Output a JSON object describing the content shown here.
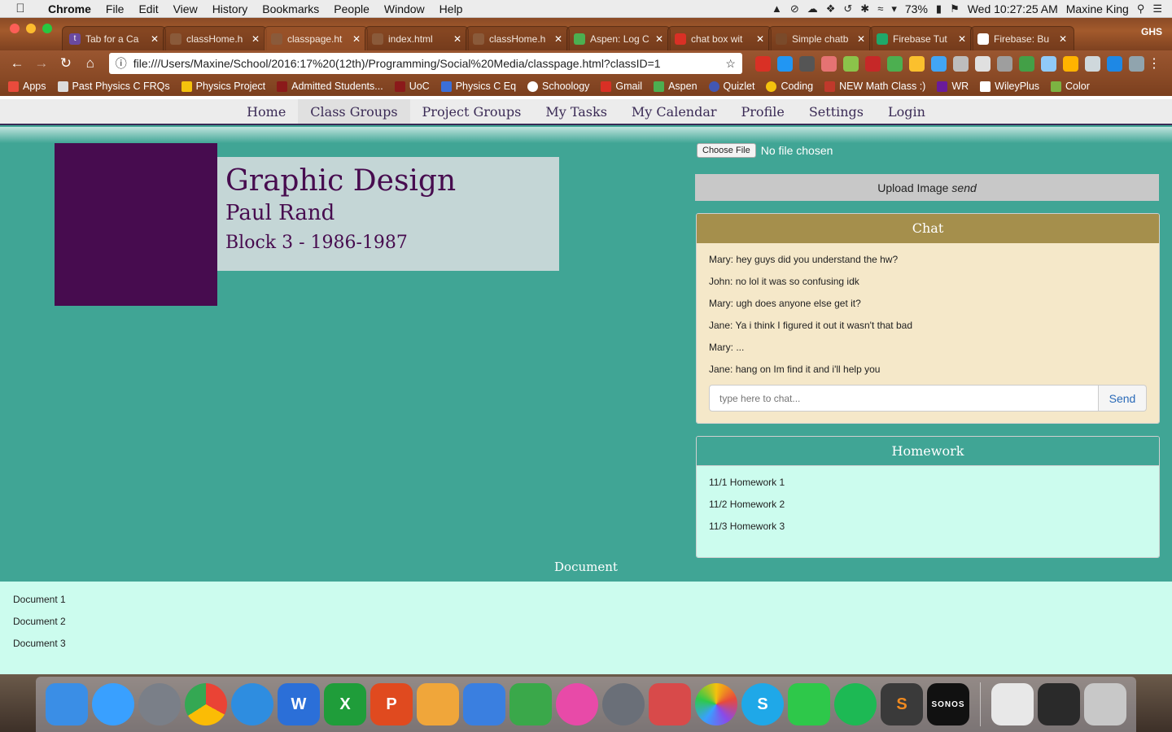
{
  "menubar": {
    "app": "Chrome",
    "items": [
      "File",
      "Edit",
      "View",
      "History",
      "Bookmarks",
      "People",
      "Window",
      "Help"
    ],
    "battery": "73%",
    "clock": "Wed 10:27:25 AM",
    "user": "Maxine King"
  },
  "tabs": [
    {
      "title": "Tab for a Ca",
      "fav": "t"
    },
    {
      "title": "classHome.h",
      "fav": ""
    },
    {
      "title": "classpage.ht",
      "fav": ""
    },
    {
      "title": "index.html",
      "fav": ""
    },
    {
      "title": "classHome.h",
      "fav": ""
    },
    {
      "title": "Aspen: Log C",
      "fav": ""
    },
    {
      "title": "chat box wit",
      "fav": ""
    },
    {
      "title": "Simple chatb",
      "fav": ""
    },
    {
      "title": "Firebase Tut",
      "fav": ""
    },
    {
      "title": "Firebase: Bu",
      "fav": ""
    }
  ],
  "profile": "GHS",
  "omnibox": {
    "url": "file:///Users/Maxine/School/2016:17%20(12th)/Programming/Social%20Media/classpage.html?classID=1"
  },
  "bookmarks": [
    {
      "label": "Apps",
      "color": "#e94b3c"
    },
    {
      "label": "Past Physics C FRQs",
      "color": "#dcdcdc"
    },
    {
      "label": "Physics Project",
      "color": "#f4c20d"
    },
    {
      "label": "Admitted Students...",
      "color": "#8b1a1a"
    },
    {
      "label": "UoC",
      "color": "#8b1a1a"
    },
    {
      "label": "Physics C Eq",
      "color": "#3b6fd8"
    },
    {
      "label": "Schoology",
      "color": "#ffffff"
    },
    {
      "label": "Gmail",
      "color": "#d93025"
    },
    {
      "label": "Aspen",
      "color": "#4caf50"
    },
    {
      "label": "Quizlet",
      "color": "#4257b2"
    },
    {
      "label": "Coding",
      "color": "#f4c20d"
    },
    {
      "label": "NEW Math Class :)",
      "color": "#c0392b"
    },
    {
      "label": "WR",
      "color": "#6a1b9a"
    },
    {
      "label": "WileyPlus",
      "color": "#ffffff"
    },
    {
      "label": "Color",
      "color": "#7cb342"
    }
  ],
  "sitenav": [
    "Home",
    "Class Groups",
    "Project Groups",
    "My Tasks",
    "My Calendar",
    "Profile",
    "Settings",
    "Login"
  ],
  "classinfo": {
    "title": "Graphic Design",
    "teacher": "Paul Rand",
    "block": "Block 3 - 1986-1987"
  },
  "file": {
    "button": "Choose File",
    "status": "No file chosen"
  },
  "upload": {
    "label": "Upload Image",
    "suffix": "send"
  },
  "chat": {
    "title": "Chat",
    "messages": [
      "Mary: hey guys did you understand the hw?",
      "John: no lol it was so confusing idk",
      "Mary: ugh does anyone else get it?",
      "Jane: Ya i think I figured it out it wasn't that bad",
      "Mary: ...",
      "Jane: hang on Im find it and i'll help you"
    ],
    "placeholder": "type here to chat...",
    "send": "Send"
  },
  "homework": {
    "title": "Homework",
    "items": [
      "11/1 Homework 1",
      "11/2 Homework 2",
      "11/3 Homework 3"
    ]
  },
  "documents": {
    "title": "Document",
    "items": [
      "Document 1",
      "Document 2",
      "Document 3"
    ]
  },
  "dock": [
    {
      "name": "finder",
      "color": "#3a8ee6",
      "glyph": ""
    },
    {
      "name": "messages",
      "color": "#39a0ff",
      "glyph": ""
    },
    {
      "name": "launchpad",
      "color": "#7a7f88",
      "glyph": ""
    },
    {
      "name": "chrome",
      "color": "#e84a3a",
      "glyph": ""
    },
    {
      "name": "pencil",
      "color": "#2e8de0",
      "glyph": ""
    },
    {
      "name": "word",
      "color": "#2b6fd8",
      "glyph": "W"
    },
    {
      "name": "excel",
      "color": "#1f9d3a",
      "glyph": "X"
    },
    {
      "name": "powerpoint",
      "color": "#e04a1f",
      "glyph": "P"
    },
    {
      "name": "pages",
      "color": "#f0a63a",
      "glyph": ""
    },
    {
      "name": "keynote",
      "color": "#3a7fe0",
      "glyph": ""
    },
    {
      "name": "numbers",
      "color": "#3aa84a",
      "glyph": ""
    },
    {
      "name": "itunes",
      "color": "#e84aa8",
      "glyph": ""
    },
    {
      "name": "system-preferences",
      "color": "#6a6f78",
      "glyph": ""
    },
    {
      "name": "grapher",
      "color": "#d84a4a",
      "glyph": ""
    },
    {
      "name": "photos",
      "color": "#f4c20d",
      "glyph": ""
    },
    {
      "name": "skype",
      "color": "#1fa8e8",
      "glyph": "S"
    },
    {
      "name": "facetime",
      "color": "#2ec84a",
      "glyph": ""
    },
    {
      "name": "spotify",
      "color": "#1db954",
      "glyph": ""
    },
    {
      "name": "sublime",
      "color": "#3a3a3a",
      "glyph": "S"
    },
    {
      "name": "sonos",
      "color": "#111111",
      "glyph": "SONOS"
    },
    {
      "name": "pdf",
      "color": "#e8e8e8",
      "glyph": ""
    },
    {
      "name": "terminal",
      "color": "#2a2a2a",
      "glyph": ""
    },
    {
      "name": "trash",
      "color": "#c8c8c8",
      "glyph": ""
    }
  ]
}
